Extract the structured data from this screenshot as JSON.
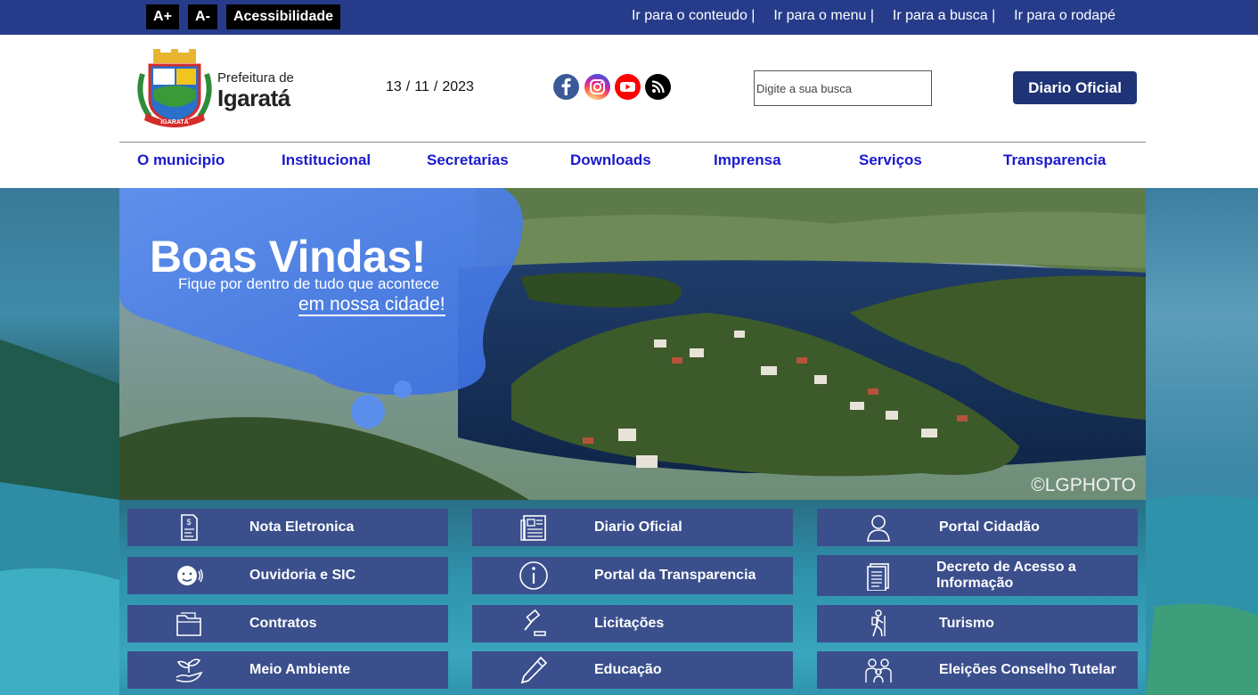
{
  "accessibility": {
    "increase_label": "A+",
    "decrease_label": "A-",
    "accessibility_label": "Acessibilidade"
  },
  "skip_links": [
    "Ir para o conteudo |",
    "Ir para o menu |",
    "Ir para a busca |",
    "Ir para o rodapé"
  ],
  "logo": {
    "line1": "Prefeitura de",
    "line2": "Igaratá",
    "crest_text": "IGARATÁ"
  },
  "date": {
    "day": "13",
    "month": "11",
    "year": "2023"
  },
  "social": [
    {
      "icon": "facebook-icon",
      "color": "#3b5998"
    },
    {
      "icon": "instagram-icon",
      "color": "#d6249f"
    },
    {
      "icon": "youtube-icon",
      "color": "#ff0000"
    },
    {
      "icon": "rss-icon",
      "color": "#000000"
    }
  ],
  "search": {
    "placeholder": "Digite a sua busca"
  },
  "header_button": "Diario Oficial",
  "nav": [
    "O municipio",
    "Institucional",
    "Secretarias",
    "Downloads",
    "Imprensa",
    "Serviços",
    "Transparencia"
  ],
  "banner": {
    "title": "Boas Vindas!",
    "subtitle": "Fique por dentro de tudo que acontece",
    "subtitle2": "em nossa cidade!",
    "credit": "©LGPHOTO"
  },
  "tiles": [
    {
      "label": "Nota Eletronica",
      "icon": "invoice-icon"
    },
    {
      "label": "Diario Oficial",
      "icon": "newspaper-icon"
    },
    {
      "label": "Portal Cidadão",
      "icon": "user-icon"
    },
    {
      "label": "Ouvidoria e SIC",
      "icon": "ombudsman-icon"
    },
    {
      "label": "Portal da Transparencia",
      "icon": "info-icon"
    },
    {
      "label": "Decreto de Acesso a Informação",
      "icon": "document-icon"
    },
    {
      "label": "Contratos",
      "icon": "folder-icon"
    },
    {
      "label": "Licitações",
      "icon": "gavel-icon"
    },
    {
      "label": "Turismo",
      "icon": "hiker-icon"
    },
    {
      "label": "Meio Ambiente",
      "icon": "plant-hand-icon"
    },
    {
      "label": "Educação",
      "icon": "pencil-icon"
    },
    {
      "label": "Eleições Conselho Tutelar",
      "icon": "family-icon"
    }
  ],
  "colors": {
    "topbar": "#263c8b",
    "nav_text": "#1a1acc",
    "tile_bg": "#3b4f8c",
    "button_bg": "#1f3476"
  }
}
